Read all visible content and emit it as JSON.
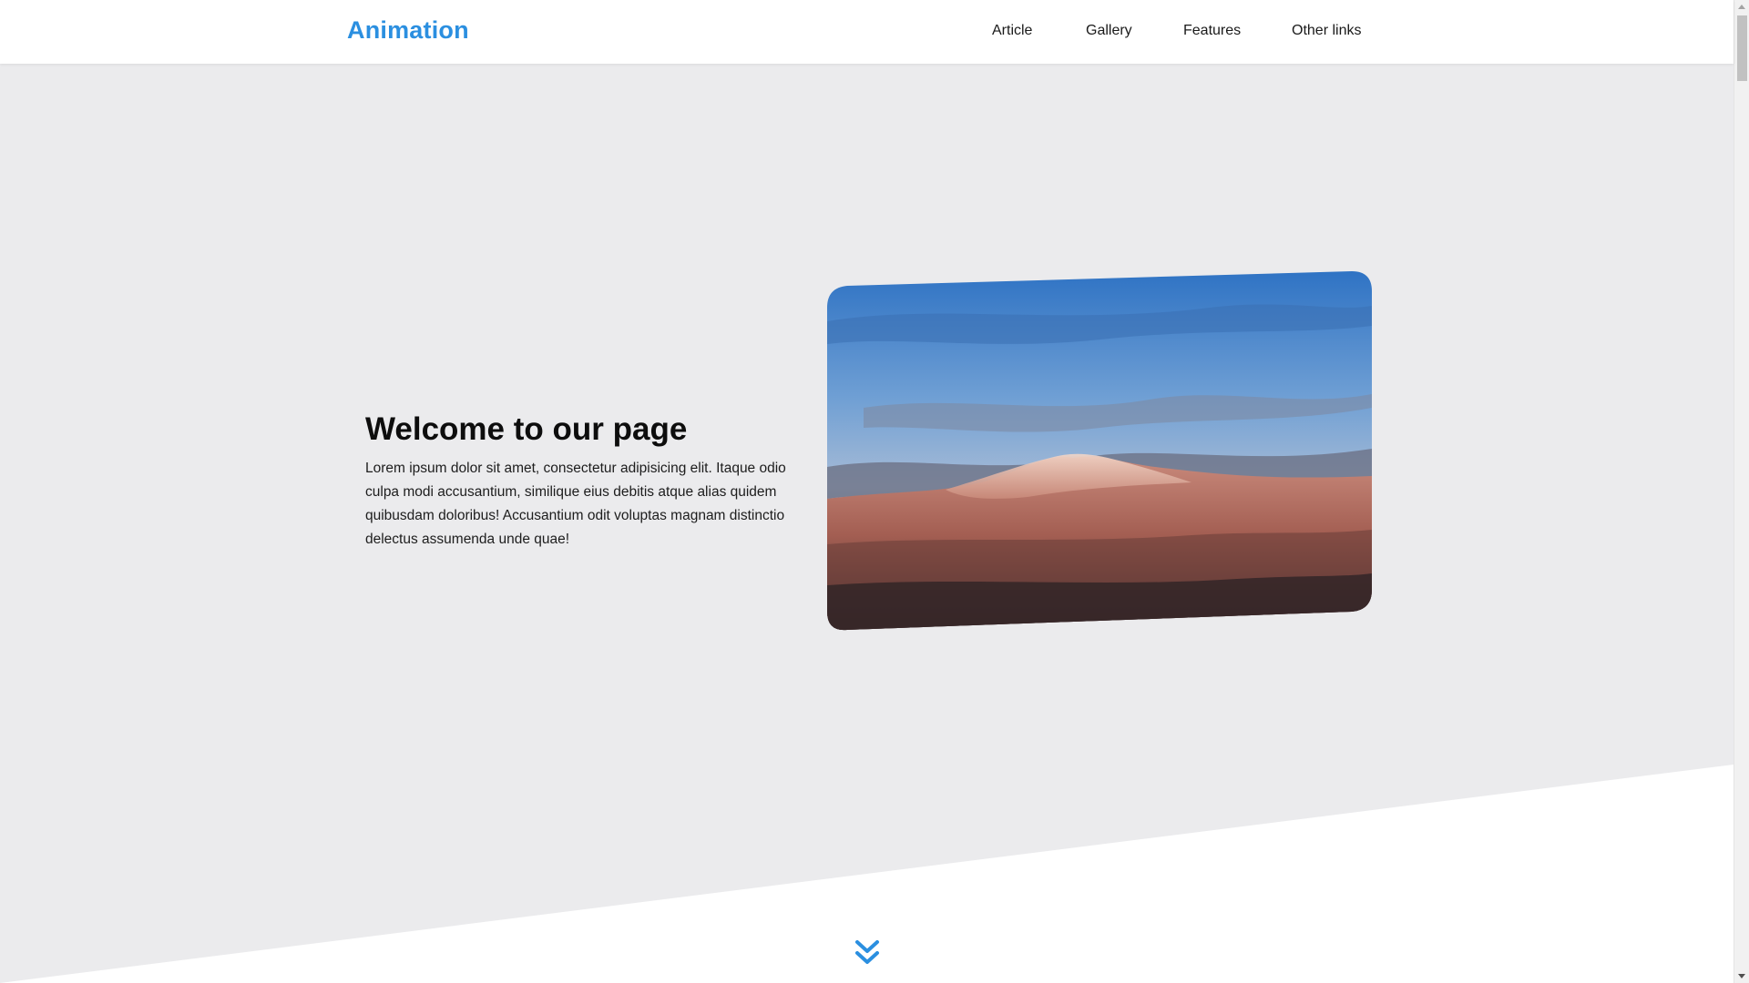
{
  "brand": {
    "name": "Animation",
    "accent_color": "#2b8fe0"
  },
  "nav": {
    "items": [
      "Article",
      "Gallery",
      "Features",
      "Other links"
    ]
  },
  "hero": {
    "title": "Welcome to our page",
    "text": "Lorem ipsum dolor sit amet, consectetur adipisicing elit. Itaque odio culpa modi accusantium, similique eius debitis atque alias quidem quibusdam doloribus! Accusantium odit voluptas magnam distinctio delectus assumenda unde quae!",
    "image": "mountain-landscape"
  },
  "icons": {
    "scroll_down": "double-chevron-down-icon"
  },
  "colors": {
    "page_bg": "#ebebed",
    "header_bg": "#ffffff",
    "section_bg": "#ffffff",
    "text": "#111111"
  }
}
